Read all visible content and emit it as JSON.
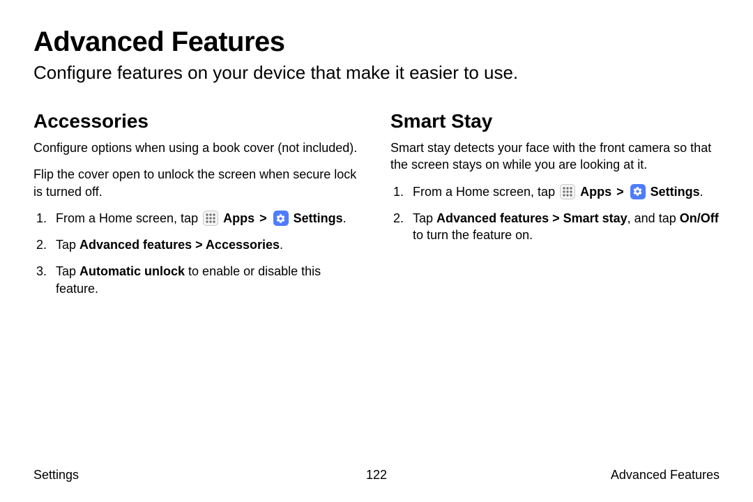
{
  "page": {
    "title": "Advanced Features",
    "subtitle": "Configure features on your device that make it easier to use."
  },
  "left": {
    "heading": "Accessories",
    "p1": "Configure options when using a book cover (not included).",
    "p2": "Flip the cover open to unlock the screen when secure lock is turned off.",
    "step1_a": "From a Home screen, tap ",
    "apps_label": "Apps",
    "chev": ">",
    "settings_label": "Settings",
    "period": ".",
    "step2_a": "Tap ",
    "step2_b": "Advanced features > Accessories",
    "step3_a": "Tap ",
    "step3_b": "Automatic unlock",
    "step3_c": " to enable or disable this feature."
  },
  "right": {
    "heading": "Smart Stay",
    "p1": "Smart stay detects your face with the front camera so that the screen stays on while you are looking at it.",
    "step1_a": "From a Home screen, tap ",
    "apps_label": "Apps",
    "chev": ">",
    "settings_label": "Settings",
    "period": ".",
    "step2_a": "Tap ",
    "step2_b": "Advanced features > Smart stay",
    "step2_c": ", and tap ",
    "step2_d": "On/Off",
    "step2_e": " to turn the feature on."
  },
  "footer": {
    "left": "Settings",
    "center": "122",
    "right": "Advanced Features"
  }
}
